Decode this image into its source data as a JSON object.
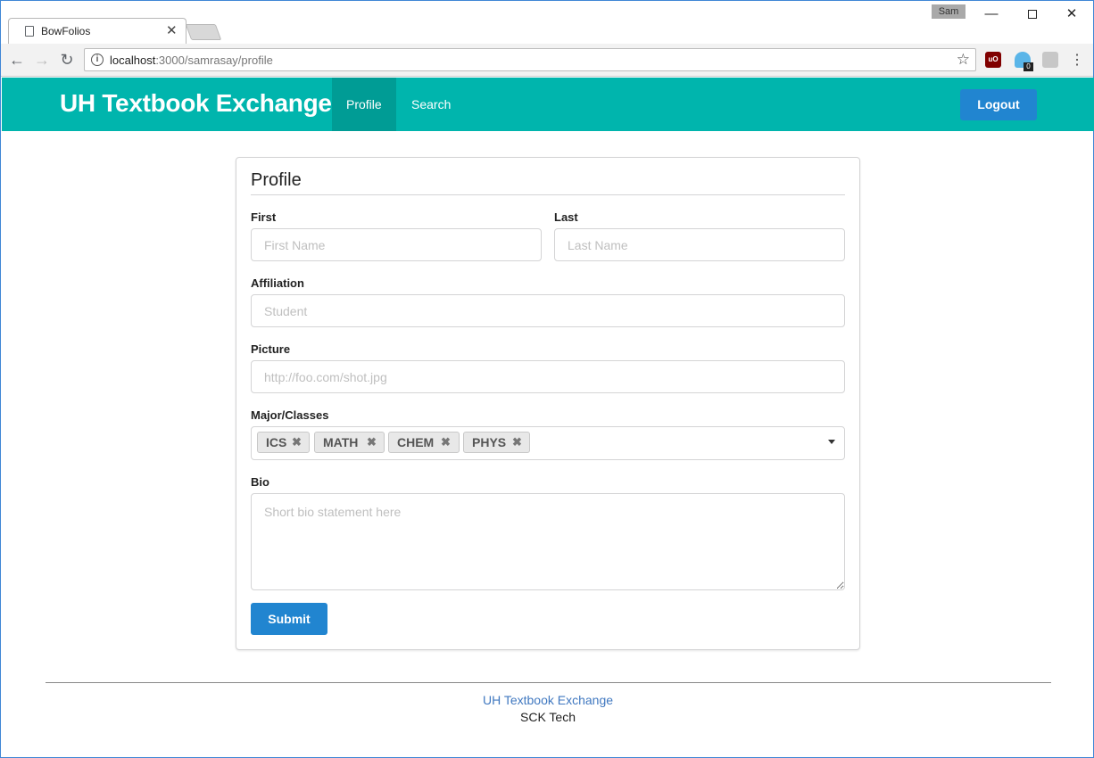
{
  "browser": {
    "tab_title": "BowFolios",
    "profile_name": "Sam",
    "url_host": "localhost",
    "url_path": ":3000/samrasay/profile",
    "extension_badge_count": "0"
  },
  "navbar": {
    "brand": "UH Textbook Exchange",
    "items": [
      {
        "label": "Profile",
        "active": true
      },
      {
        "label": "Search",
        "active": false
      }
    ],
    "logout_label": "Logout",
    "color": "#00b5ad"
  },
  "form": {
    "title": "Profile",
    "first": {
      "label": "First",
      "placeholder": "First Name"
    },
    "last": {
      "label": "Last",
      "placeholder": "Last Name"
    },
    "affiliation": {
      "label": "Affiliation",
      "placeholder": "Student"
    },
    "picture": {
      "label": "Picture",
      "placeholder": "http://foo.com/shot.jpg"
    },
    "majors": {
      "label": "Major/Classes",
      "selected": [
        "ICS",
        "MATH",
        "CHEM",
        "PHYS"
      ]
    },
    "bio": {
      "label": "Bio",
      "placeholder": "Short bio statement here"
    },
    "submit_label": "Submit",
    "button_color": "#2185d0"
  },
  "footer": {
    "link": "UH Textbook Exchange",
    "company": "SCK Tech"
  }
}
